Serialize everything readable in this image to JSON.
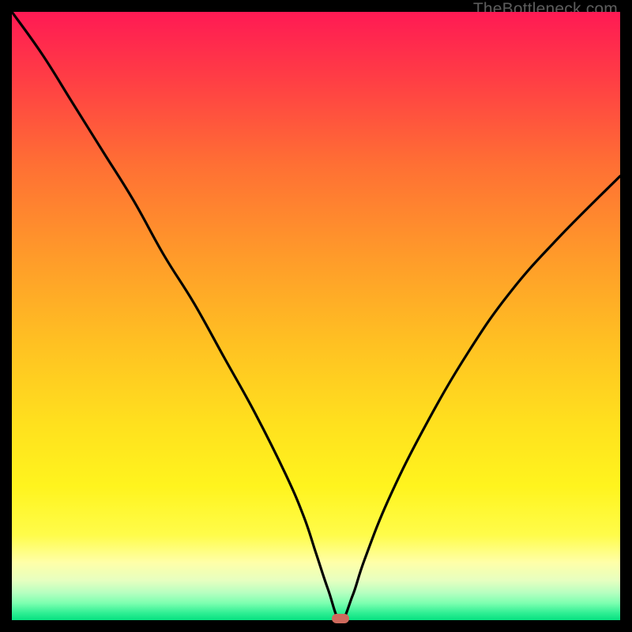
{
  "watermark": "TheBottleneck.com",
  "chart_data": {
    "type": "line",
    "title": "",
    "xlabel": "",
    "ylabel": "",
    "xlim": [
      0,
      100
    ],
    "ylim": [
      0,
      100
    ],
    "description": "Bottleneck V-curve over a red-yellow-green vertical gradient; minimum near x≈54; marker at minimum.",
    "gradient_stops": [
      {
        "offset": 0.0,
        "color": "#ff1a54"
      },
      {
        "offset": 0.1,
        "color": "#ff3a46"
      },
      {
        "offset": 0.25,
        "color": "#ff6f34"
      },
      {
        "offset": 0.4,
        "color": "#ff9a2a"
      },
      {
        "offset": 0.55,
        "color": "#ffc222"
      },
      {
        "offset": 0.68,
        "color": "#ffe11e"
      },
      {
        "offset": 0.78,
        "color": "#fff41e"
      },
      {
        "offset": 0.86,
        "color": "#fffc4a"
      },
      {
        "offset": 0.905,
        "color": "#ffffa8"
      },
      {
        "offset": 0.935,
        "color": "#e6ffc0"
      },
      {
        "offset": 0.955,
        "color": "#b6ffc0"
      },
      {
        "offset": 0.972,
        "color": "#7dffb0"
      },
      {
        "offset": 0.988,
        "color": "#30ef94"
      },
      {
        "offset": 1.0,
        "color": "#07e180"
      }
    ],
    "series": [
      {
        "name": "bottleneck-curve",
        "x": [
          0,
          5,
          10,
          15,
          20,
          25,
          30,
          35,
          40,
          45,
          48,
          50,
          52,
          54,
          56,
          58,
          62,
          68,
          75,
          82,
          90,
          100
        ],
        "y": [
          100,
          93,
          85,
          77,
          69,
          60,
          52,
          43,
          34,
          24,
          17,
          11,
          5,
          0,
          4,
          10,
          20,
          32,
          44,
          54,
          63,
          73
        ]
      }
    ],
    "marker": {
      "x": 54,
      "y": 0,
      "color": "#cf6a5d"
    }
  }
}
